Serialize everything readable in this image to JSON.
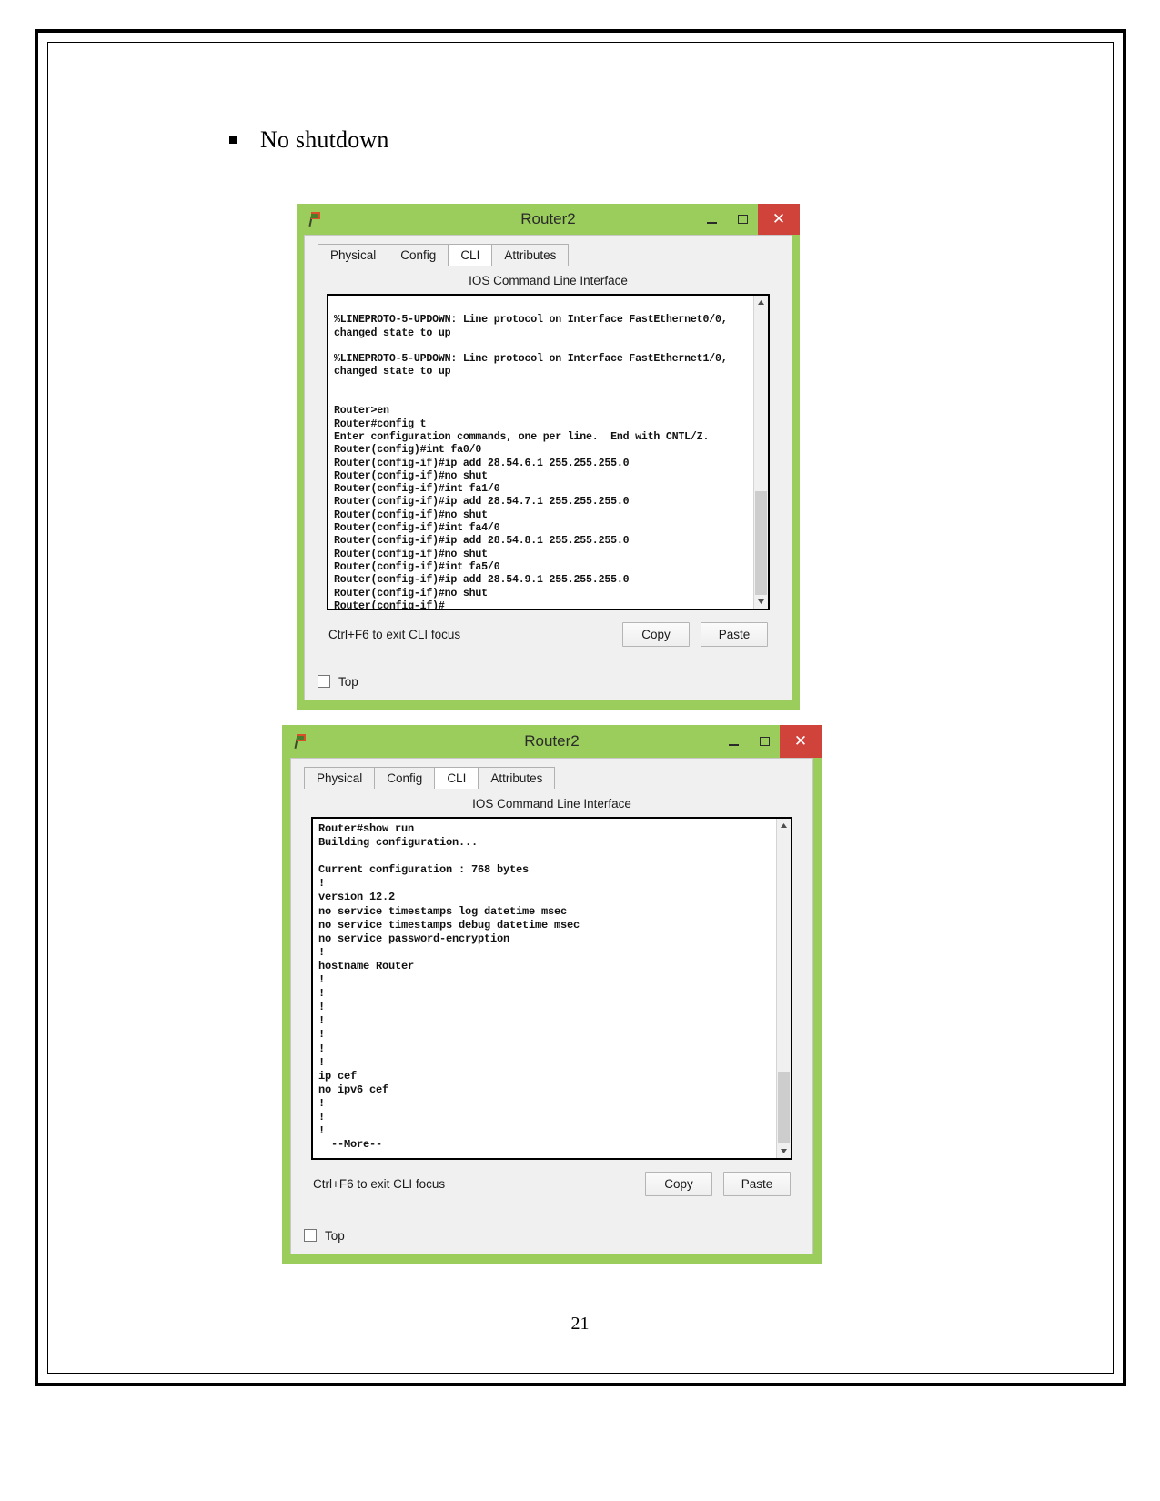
{
  "document": {
    "bullet_text": "No shutdown",
    "page_number": "21"
  },
  "windows": [
    {
      "title": "Router2",
      "icon": "packet-tracer-flag-icon",
      "controls": {
        "minimize": "–",
        "maximize": "❐",
        "close": "✕"
      },
      "tabs": [
        {
          "label": "Physical",
          "active": false
        },
        {
          "label": "Config",
          "active": false
        },
        {
          "label": "CLI",
          "active": true
        },
        {
          "label": "Attributes",
          "active": false
        }
      ],
      "panel_title": "IOS Command Line Interface",
      "terminal_text": "\n%LINEPROTO-5-UPDOWN: Line protocol on Interface FastEthernet0/0,\nchanged state to up\n\n%LINEPROTO-5-UPDOWN: Line protocol on Interface FastEthernet1/0,\nchanged state to up\n\n\nRouter>en\nRouter#config t\nEnter configuration commands, one per line.  End with CNTL/Z.\nRouter(config)#int fa0/0\nRouter(config-if)#ip add 28.54.6.1 255.255.255.0\nRouter(config-if)#no shut\nRouter(config-if)#int fa1/0\nRouter(config-if)#ip add 28.54.7.1 255.255.255.0\nRouter(config-if)#no shut\nRouter(config-if)#int fa4/0\nRouter(config-if)#ip add 28.54.8.1 255.255.255.0\nRouter(config-if)#no shut\nRouter(config-if)#int fa5/0\nRouter(config-if)#ip add 28.54.9.1 255.255.255.0\nRouter(config-if)#no shut\nRouter(config-if)#",
      "hint": "Ctrl+F6 to exit CLI focus",
      "copy_label": "Copy",
      "paste_label": "Paste",
      "top_checkbox_label": "Top",
      "top_checkbox_checked": false
    },
    {
      "title": "Router2",
      "icon": "packet-tracer-flag-icon",
      "controls": {
        "minimize": "–",
        "maximize": "❐",
        "close": "✕"
      },
      "tabs": [
        {
          "label": "Physical",
          "active": false
        },
        {
          "label": "Config",
          "active": false
        },
        {
          "label": "CLI",
          "active": true
        },
        {
          "label": "Attributes",
          "active": false
        }
      ],
      "panel_title": "IOS Command Line Interface",
      "terminal_text": "Router#show run\nBuilding configuration...\n\nCurrent configuration : 768 bytes\n!\nversion 12.2\nno service timestamps log datetime msec\nno service timestamps debug datetime msec\nno service password-encryption\n!\nhostname Router\n!\n!\n!\n!\n!\n!\n!\nip cef\nno ipv6 cef\n!\n!\n!\n  --More--",
      "hint": "Ctrl+F6 to exit CLI focus",
      "copy_label": "Copy",
      "paste_label": "Paste",
      "top_checkbox_label": "Top",
      "top_checkbox_checked": false
    }
  ],
  "colors": {
    "window_chrome": "#9acd5c",
    "close_button": "#d0433b",
    "panel_bg": "#f0f0f0",
    "terminal_bg": "#ffffff"
  }
}
